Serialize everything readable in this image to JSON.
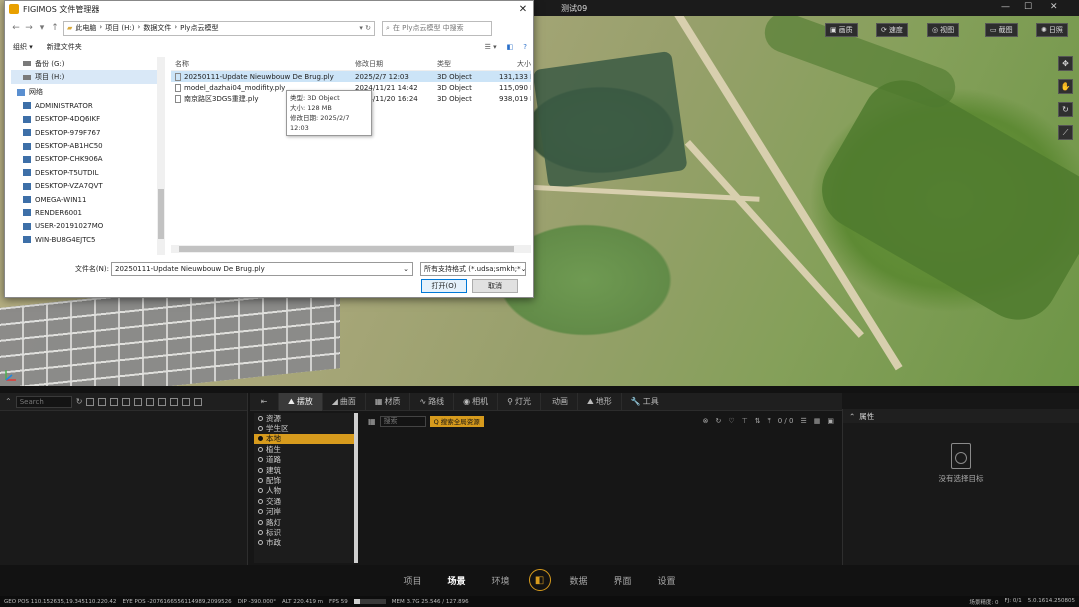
{
  "viewport": {
    "title": "测试09",
    "toolbar": [
      {
        "icon": "image-icon",
        "label": "画质"
      },
      {
        "icon": "speed-icon",
        "label": "速度"
      },
      {
        "icon": "view-icon",
        "label": "视图"
      },
      {
        "icon": "screenshot-icon",
        "label": "截图"
      },
      {
        "icon": "sun-icon",
        "label": "日照"
      }
    ]
  },
  "dialog": {
    "title": "FIGIMOS 文件管理器",
    "address": [
      "此电脑",
      "项目 (H:)",
      "数据文件",
      "Ply点云模型"
    ],
    "search_placeholder": "在 Ply点云模型 中搜索",
    "organize": "组织 ▾",
    "new_folder": "新建文件夹",
    "nav_items": [
      {
        "label": "备份 (G:)",
        "type": "drive"
      },
      {
        "label": "项目 (H:)",
        "type": "drive",
        "selected": true
      },
      {
        "label": "网络",
        "type": "net"
      },
      {
        "label": "ADMINISTRATOR",
        "type": "pc"
      },
      {
        "label": "DESKTOP-4DQ6IKF",
        "type": "pc"
      },
      {
        "label": "DESKTOP-979F767",
        "type": "pc"
      },
      {
        "label": "DESKTOP-AB1HC50",
        "type": "pc"
      },
      {
        "label": "DESKTOP-CHK906A",
        "type": "pc"
      },
      {
        "label": "DESKTOP-T5UTDIL",
        "type": "pc"
      },
      {
        "label": "DESKTOP-VZA7QVT",
        "type": "pc"
      },
      {
        "label": "OMEGA-WIN11",
        "type": "pc"
      },
      {
        "label": "RENDER6001",
        "type": "pc"
      },
      {
        "label": "USER-20191027MO",
        "type": "pc"
      },
      {
        "label": "WIN-BU8G4EJTC5",
        "type": "pc"
      }
    ],
    "columns": [
      "名称",
      "修改日期",
      "类型",
      "大小"
    ],
    "files": [
      {
        "name": "20250111-Update Nieuwbouw De Brug.ply",
        "date": "2025/2/7 12:03",
        "type": "3D Object",
        "size": "131,133 KB",
        "selected": true
      },
      {
        "name": "model_dazhai04_modifity.ply",
        "date": "2024/11/21 14:42",
        "type": "3D Object",
        "size": "115,090 KB"
      },
      {
        "name": "南京路区3DGS重建.ply",
        "date": "2024/11/20 16:24",
        "type": "3D Object",
        "size": "938,019 KB"
      }
    ],
    "tooltip": [
      "类型: 3D Object",
      "大小: 128 MB",
      "修改日期: 2025/2/7 12:03"
    ],
    "filename_label": "文件名(N):",
    "filename_value": "20250111-Update Nieuwbouw De Brug.ply",
    "filter_value": "所有支持格式 (*.udsa;smkh;*",
    "open_button": "打开(O)",
    "cancel_button": "取消"
  },
  "outliner": {
    "search_placeholder": "Search"
  },
  "center": {
    "tabs": [
      {
        "icon": "⛰",
        "label": "摆放",
        "active": true
      },
      {
        "icon": "◢",
        "label": "曲面"
      },
      {
        "icon": "▦",
        "label": "材质"
      },
      {
        "icon": "∿",
        "label": "路线"
      },
      {
        "icon": "◉",
        "label": "相机"
      },
      {
        "icon": "⚲",
        "label": "灯光"
      },
      {
        "icon": "",
        "label": "动画"
      },
      {
        "icon": "⛰",
        "label": "地形"
      },
      {
        "icon": "🔧",
        "label": "工具"
      }
    ],
    "categories": [
      {
        "label": "资源"
      },
      {
        "label": "学生区"
      },
      {
        "label": "本地",
        "selected": true
      },
      {
        "label": "植生"
      },
      {
        "label": "道路"
      },
      {
        "label": "建筑"
      },
      {
        "label": "配饰"
      },
      {
        "label": "人物"
      },
      {
        "label": "交通"
      },
      {
        "label": "河岸"
      },
      {
        "label": "路灯"
      },
      {
        "label": "标识"
      },
      {
        "label": "市政"
      }
    ],
    "asset_search_placeholder": "搜索",
    "asset_chip": "Q 搜索全局资源",
    "asset_count": "0 / 0"
  },
  "props": {
    "title": "属性",
    "empty_text": "没有选择目标"
  },
  "bottomnav": {
    "items": [
      "项目",
      "场景",
      "环境",
      "数据",
      "界面",
      "设置"
    ],
    "active": "场景"
  },
  "status": {
    "geo_pos": "GEO POS  110.152635,19.345110.220.42",
    "eye_pos": "EYE POS  -2076166556114989,2099526",
    "dip": "DIP  -390.000°",
    "alt": "ALT  220.419 m",
    "fps": "FPS  59",
    "mem": "MEM  3.7G  25.546 / 127.896",
    "mem_fraction": 0.2,
    "right1": "场景精度: 0",
    "right2": "FJ: 0/1",
    "right3": "5.0.1614.250805"
  }
}
